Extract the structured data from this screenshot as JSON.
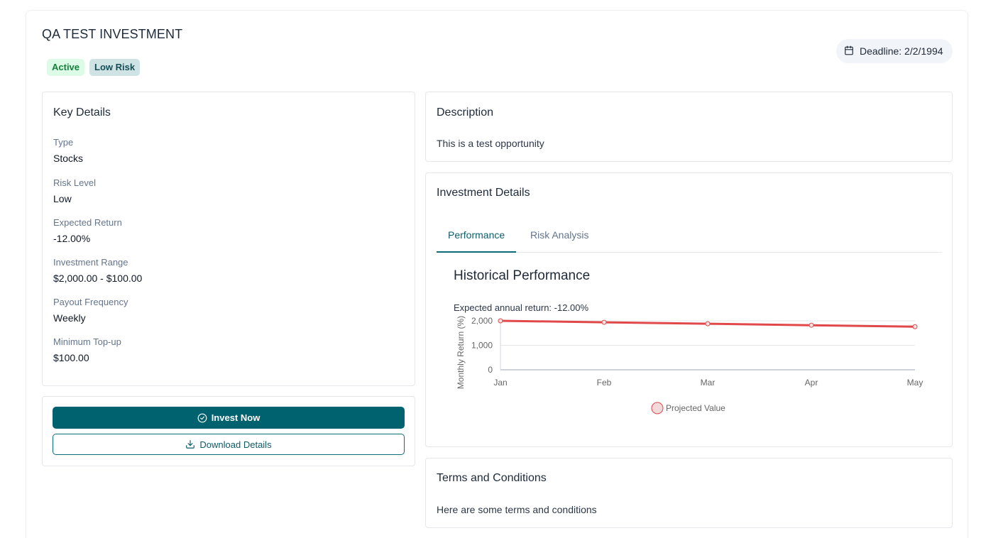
{
  "header": {
    "title": "QA TEST INVESTMENT",
    "badges": {
      "status": "Active",
      "risk": "Low Risk"
    },
    "deadline": "Deadline: 2/2/1994"
  },
  "key_details": {
    "title": "Key Details",
    "items": [
      {
        "label": "Type",
        "value": "Stocks"
      },
      {
        "label": "Risk Level",
        "value": "Low"
      },
      {
        "label": "Expected Return",
        "value": "-12.00%"
      },
      {
        "label": "Investment Range",
        "value": "$2,000.00 - $100.00"
      },
      {
        "label": "Payout Frequency",
        "value": "Weekly"
      },
      {
        "label": "Minimum Top-up",
        "value": "$100.00"
      }
    ]
  },
  "actions": {
    "invest_label": "Invest Now",
    "download_label": "Download Details"
  },
  "description": {
    "title": "Description",
    "text": "This is a test opportunity"
  },
  "investment_details": {
    "title": "Investment Details",
    "tabs": [
      "Performance",
      "Risk Analysis"
    ],
    "chart_title": "Historical Performance",
    "chart_subtitle": "Expected annual return: -12.00%"
  },
  "terms": {
    "title": "Terms and Conditions",
    "text": "Here are some terms and conditions"
  },
  "colors": {
    "accent": "#00616f",
    "line": "#e0484a",
    "active_badge_bg": "#dcfce7",
    "risk_badge_bg": "#cfe3e5"
  },
  "chart_data": {
    "type": "line",
    "categories": [
      "Jan",
      "Feb",
      "Mar",
      "Apr",
      "May"
    ],
    "series": [
      {
        "name": "Projected Value",
        "values": [
          2000,
          1940,
          1880,
          1820,
          1760
        ]
      }
    ],
    "ylabel": "Monthly Return (%)",
    "yticks": [
      "0",
      "1,000",
      "2,000"
    ],
    "ylim": [
      0,
      2000
    ],
    "legend_position": "bottom",
    "grid": true
  }
}
